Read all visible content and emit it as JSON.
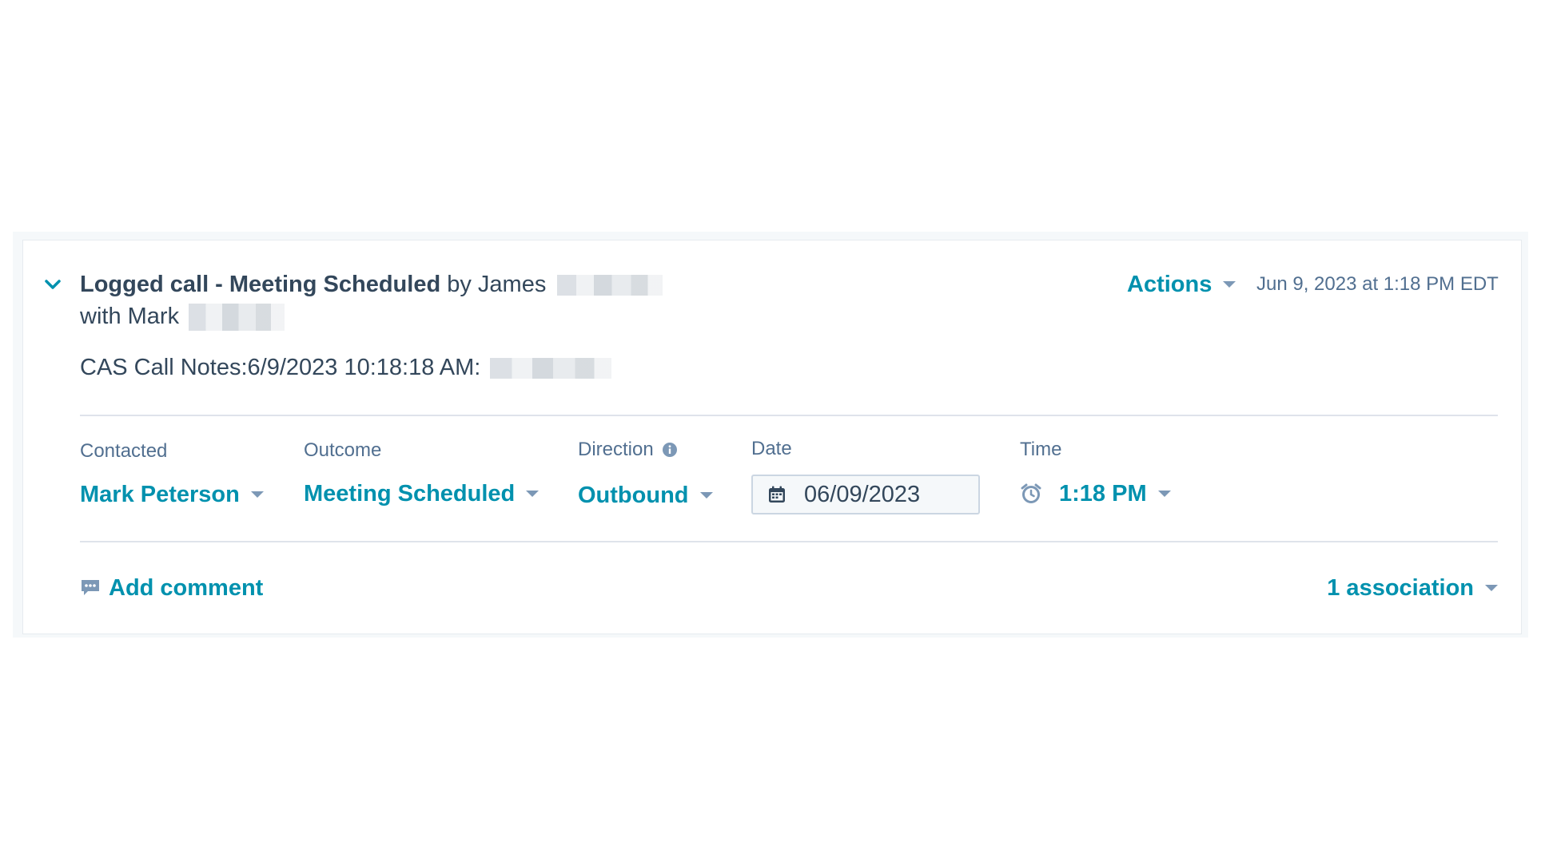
{
  "activity": {
    "title_bold": "Logged call - Meeting Scheduled",
    "by_text": "by James",
    "with_text": "with Mark",
    "notes": "CAS Call Notes:6/9/2023 10:18:18 AM:",
    "actions_label": "Actions",
    "timestamp": "Jun 9, 2023 at 1:18 PM EDT"
  },
  "fields": {
    "contacted": {
      "label": "Contacted",
      "value": "Mark Peterson"
    },
    "outcome": {
      "label": "Outcome",
      "value": "Meeting Scheduled"
    },
    "direction": {
      "label": "Direction",
      "value": "Outbound"
    },
    "date": {
      "label": "Date",
      "value": "06/09/2023"
    },
    "time": {
      "label": "Time",
      "value": "1:18 PM"
    }
  },
  "footer": {
    "add_comment": "Add comment",
    "associations": "1 association"
  },
  "colors": {
    "accent": "#0091ae",
    "text": "#33475b",
    "muted": "#516f90",
    "divider": "#dfe3eb"
  },
  "icons": [
    "chevron-down-icon",
    "caret-down-icon",
    "info-icon",
    "calendar-icon",
    "alarm-clock-icon",
    "comment-icon"
  ]
}
